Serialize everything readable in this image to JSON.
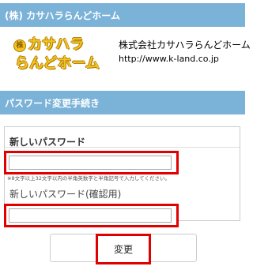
{
  "header": {
    "title": "(株) カサハラらんどホーム"
  },
  "logo": {
    "circle_mark": "株",
    "line1": "カサハラ",
    "line2": "らんどホーム",
    "company_name": "株式会社カサハラらんどホーム",
    "url": "http://www.k-land.co.jp"
  },
  "section": {
    "title": "パスワード変更手続き"
  },
  "form": {
    "new_password_label": "新しいパスワード",
    "new_password_value": "",
    "note": "※8文字以上32文字以内の半角英数字と半角記号で入力してください。",
    "confirm_password_label": "新しいパスワード(確認用)",
    "confirm_password_value": "",
    "submit_label": "変更"
  },
  "colors": {
    "header_bar": "#7bb2d8",
    "highlight": "#e00000",
    "logo_yellow": "#f3c41f"
  }
}
